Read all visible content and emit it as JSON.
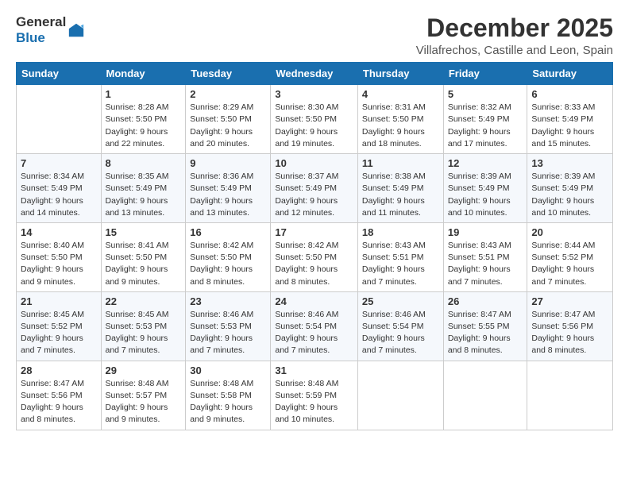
{
  "logo": {
    "general": "General",
    "blue": "Blue"
  },
  "title": "December 2025",
  "subtitle": "Villafrechos, Castille and Leon, Spain",
  "days_of_week": [
    "Sunday",
    "Monday",
    "Tuesday",
    "Wednesday",
    "Thursday",
    "Friday",
    "Saturday"
  ],
  "weeks": [
    [
      {
        "day": "",
        "info": ""
      },
      {
        "day": "1",
        "info": "Sunrise: 8:28 AM\nSunset: 5:50 PM\nDaylight: 9 hours\nand 22 minutes."
      },
      {
        "day": "2",
        "info": "Sunrise: 8:29 AM\nSunset: 5:50 PM\nDaylight: 9 hours\nand 20 minutes."
      },
      {
        "day": "3",
        "info": "Sunrise: 8:30 AM\nSunset: 5:50 PM\nDaylight: 9 hours\nand 19 minutes."
      },
      {
        "day": "4",
        "info": "Sunrise: 8:31 AM\nSunset: 5:50 PM\nDaylight: 9 hours\nand 18 minutes."
      },
      {
        "day": "5",
        "info": "Sunrise: 8:32 AM\nSunset: 5:49 PM\nDaylight: 9 hours\nand 17 minutes."
      },
      {
        "day": "6",
        "info": "Sunrise: 8:33 AM\nSunset: 5:49 PM\nDaylight: 9 hours\nand 15 minutes."
      }
    ],
    [
      {
        "day": "7",
        "info": "Sunrise: 8:34 AM\nSunset: 5:49 PM\nDaylight: 9 hours\nand 14 minutes."
      },
      {
        "day": "8",
        "info": "Sunrise: 8:35 AM\nSunset: 5:49 PM\nDaylight: 9 hours\nand 13 minutes."
      },
      {
        "day": "9",
        "info": "Sunrise: 8:36 AM\nSunset: 5:49 PM\nDaylight: 9 hours\nand 13 minutes."
      },
      {
        "day": "10",
        "info": "Sunrise: 8:37 AM\nSunset: 5:49 PM\nDaylight: 9 hours\nand 12 minutes."
      },
      {
        "day": "11",
        "info": "Sunrise: 8:38 AM\nSunset: 5:49 PM\nDaylight: 9 hours\nand 11 minutes."
      },
      {
        "day": "12",
        "info": "Sunrise: 8:39 AM\nSunset: 5:49 PM\nDaylight: 9 hours\nand 10 minutes."
      },
      {
        "day": "13",
        "info": "Sunrise: 8:39 AM\nSunset: 5:49 PM\nDaylight: 9 hours\nand 10 minutes."
      }
    ],
    [
      {
        "day": "14",
        "info": "Sunrise: 8:40 AM\nSunset: 5:50 PM\nDaylight: 9 hours\nand 9 minutes."
      },
      {
        "day": "15",
        "info": "Sunrise: 8:41 AM\nSunset: 5:50 PM\nDaylight: 9 hours\nand 9 minutes."
      },
      {
        "day": "16",
        "info": "Sunrise: 8:42 AM\nSunset: 5:50 PM\nDaylight: 9 hours\nand 8 minutes."
      },
      {
        "day": "17",
        "info": "Sunrise: 8:42 AM\nSunset: 5:50 PM\nDaylight: 9 hours\nand 8 minutes."
      },
      {
        "day": "18",
        "info": "Sunrise: 8:43 AM\nSunset: 5:51 PM\nDaylight: 9 hours\nand 7 minutes."
      },
      {
        "day": "19",
        "info": "Sunrise: 8:43 AM\nSunset: 5:51 PM\nDaylight: 9 hours\nand 7 minutes."
      },
      {
        "day": "20",
        "info": "Sunrise: 8:44 AM\nSunset: 5:52 PM\nDaylight: 9 hours\nand 7 minutes."
      }
    ],
    [
      {
        "day": "21",
        "info": "Sunrise: 8:45 AM\nSunset: 5:52 PM\nDaylight: 9 hours\nand 7 minutes."
      },
      {
        "day": "22",
        "info": "Sunrise: 8:45 AM\nSunset: 5:53 PM\nDaylight: 9 hours\nand 7 minutes."
      },
      {
        "day": "23",
        "info": "Sunrise: 8:46 AM\nSunset: 5:53 PM\nDaylight: 9 hours\nand 7 minutes."
      },
      {
        "day": "24",
        "info": "Sunrise: 8:46 AM\nSunset: 5:54 PM\nDaylight: 9 hours\nand 7 minutes."
      },
      {
        "day": "25",
        "info": "Sunrise: 8:46 AM\nSunset: 5:54 PM\nDaylight: 9 hours\nand 7 minutes."
      },
      {
        "day": "26",
        "info": "Sunrise: 8:47 AM\nSunset: 5:55 PM\nDaylight: 9 hours\nand 8 minutes."
      },
      {
        "day": "27",
        "info": "Sunrise: 8:47 AM\nSunset: 5:56 PM\nDaylight: 9 hours\nand 8 minutes."
      }
    ],
    [
      {
        "day": "28",
        "info": "Sunrise: 8:47 AM\nSunset: 5:56 PM\nDaylight: 9 hours\nand 8 minutes."
      },
      {
        "day": "29",
        "info": "Sunrise: 8:48 AM\nSunset: 5:57 PM\nDaylight: 9 hours\nand 9 minutes."
      },
      {
        "day": "30",
        "info": "Sunrise: 8:48 AM\nSunset: 5:58 PM\nDaylight: 9 hours\nand 9 minutes."
      },
      {
        "day": "31",
        "info": "Sunrise: 8:48 AM\nSunset: 5:59 PM\nDaylight: 9 hours\nand 10 minutes."
      },
      {
        "day": "",
        "info": ""
      },
      {
        "day": "",
        "info": ""
      },
      {
        "day": "",
        "info": ""
      }
    ]
  ]
}
